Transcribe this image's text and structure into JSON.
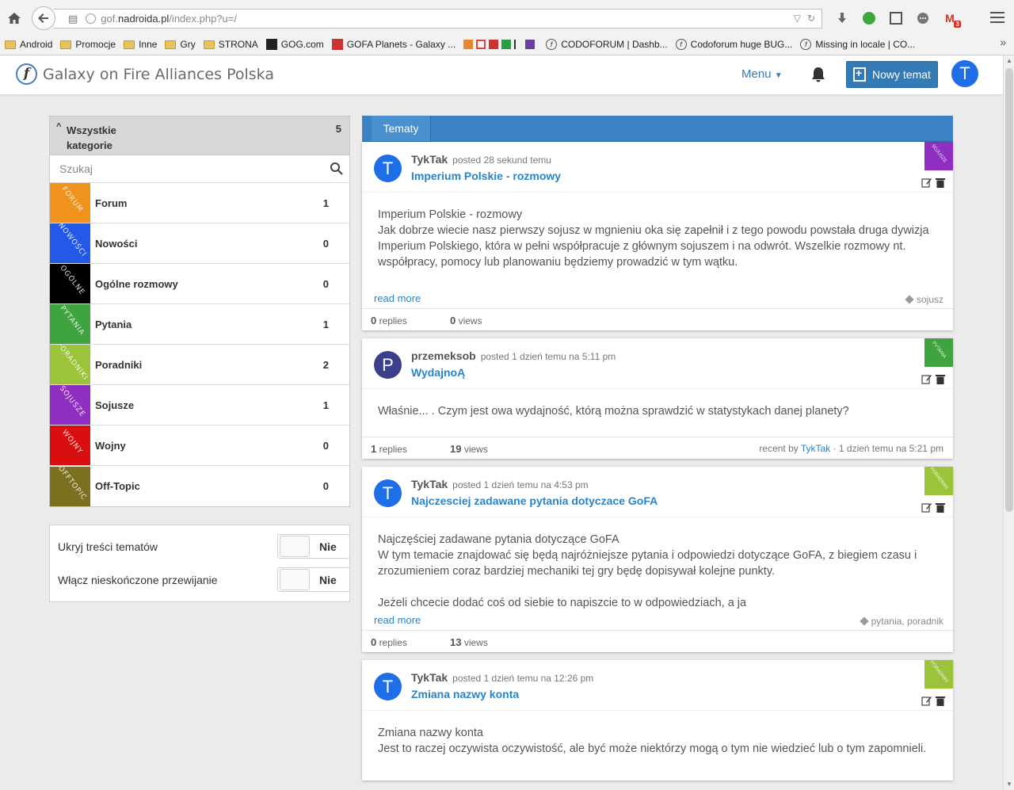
{
  "browser": {
    "url_prefix": "gof.",
    "url_domain": "nadroida.pl",
    "url_path": "/index.php?u=/",
    "gmail_count": "3",
    "bookmarks": [
      {
        "label": "Android",
        "icon": "folder"
      },
      {
        "label": "Promocje",
        "icon": "folder"
      },
      {
        "label": "Inne",
        "icon": "folder"
      },
      {
        "label": "Gry",
        "icon": "folder"
      },
      {
        "label": "STRONA",
        "icon": "folder"
      },
      {
        "label": "GOG.com",
        "icon": "gog"
      },
      {
        "label": "GOFA Planets - Galaxy ...",
        "icon": "gofa"
      },
      {
        "label": "CODOFORUM | Dashb...",
        "icon": "codo"
      },
      {
        "label": "Codoforum huge BUG...",
        "icon": "codo"
      },
      {
        "label": "Missing in locale | CO...",
        "icon": "codo"
      }
    ]
  },
  "header": {
    "logo_letter": "f",
    "site_title": "Galaxy on Fire Alliances Polska",
    "menu_label": "Menu",
    "new_topic_label": "Nowy temat",
    "user_initial": "T"
  },
  "sidebar": {
    "all_categories_label": "Wszystkie kategorie",
    "all_categories_count": "5",
    "search_placeholder": "Szukaj",
    "categories": [
      {
        "name": "Forum",
        "count": "1",
        "color": "#f0921e",
        "tile_text": "FORUM"
      },
      {
        "name": "Nowości",
        "count": "0",
        "color": "#2259e6",
        "tile_text": "NOWOŚCI"
      },
      {
        "name": "Ogólne rozmowy",
        "count": "0",
        "color": "#000000",
        "tile_text": "OGÓLNE"
      },
      {
        "name": "Pytania",
        "count": "1",
        "color": "#3fa43f",
        "tile_text": "PYTANIA"
      },
      {
        "name": "Poradniki",
        "count": "2",
        "color": "#9bc43a",
        "tile_text": "PORADNIKI"
      },
      {
        "name": "Sojusze",
        "count": "1",
        "color": "#8f2fc2",
        "tile_text": "SOJUSZE"
      },
      {
        "name": "Wojny",
        "count": "0",
        "color": "#d90e0e",
        "tile_text": "WOJNY"
      },
      {
        "name": "Off-Topic",
        "count": "0",
        "color": "#7a7020",
        "tile_text": "OFFTOPIC"
      }
    ],
    "settings": [
      {
        "label": "Ukryj treści tematów",
        "value": "Nie"
      },
      {
        "label": "Włącz nieskończone przewijanie",
        "value": "Nie"
      }
    ]
  },
  "main": {
    "tab_label": "Tematy",
    "read_more": "read more",
    "replies_label": "replies",
    "views_label": "views",
    "recent_by_label": "recent by",
    "topics": [
      {
        "author": "TykTak",
        "avatar": "T",
        "avatar_color": "#1e6ee8",
        "posted": "posted 28 sekund temu",
        "title": "Imperium Polskie - rozmowy",
        "badge_color": "#8f2fc2",
        "badge_text": "SOJUSZE",
        "body": [
          "Imperium Polskie - rozmowy",
          "Jak dobrze wiecie nasz pierwszy sojusz w mgnieniu oka się zapełnił i z tego powodu powstała druga dywizja Imperium Polskiego, która w pełni współpracuje z głównym sojuszem i na odwrót. Wszelkie rozmowy nt. współpracy, pomocy lub planowaniu będziemy prowadzić w tym wątku."
        ],
        "tags": "sojusz",
        "replies": "0",
        "views": "0"
      },
      {
        "author": "przemeksob",
        "avatar": "P",
        "avatar_color": "#3b3f8c",
        "posted": "posted 1 dzień temu na 5:11 pm",
        "title": "WydajnoĄ",
        "badge_color": "#3fa43f",
        "badge_text": "PYTANIA",
        "body": [
          "Właśnie... . Czym jest owa wydajność, którą można sprawdzić w statystykach danej planety?"
        ],
        "replies": "1",
        "views": "19",
        "recent_user": "TykTak",
        "recent_time": "1 dzień temu na 5:21 pm"
      },
      {
        "author": "TykTak",
        "avatar": "T",
        "avatar_color": "#1e6ee8",
        "posted": "posted 1 dzień temu na 4:53 pm",
        "title": "Najczesciej zadawane pytania dotyczace GoFA",
        "badge_color": "#9bc43a",
        "badge_text": "PORADNIKI",
        "body": [
          "Najczęściej zadawane pytania dotyczące GoFA",
          "W tym temacie znajdować się będą najróżniejsze pytania i odpowiedzi dotyczące GoFA, z biegiem czasu i zrozumieniem coraz bardziej mechaniki tej gry będę dopisywał kolejne punkty.",
          "",
          "Jeżeli chcecie dodać coś od siebie to napiszcie to w odpowiedziach, a ja"
        ],
        "tags": "pytania, poradnik",
        "replies": "0",
        "views": "13"
      },
      {
        "author": "TykTak",
        "avatar": "T",
        "avatar_color": "#1e6ee8",
        "posted": "posted 1 dzień temu na 12:26 pm",
        "title": "Zmiana nazwy konta",
        "badge_color": "#9bc43a",
        "badge_text": "PORADNIKI",
        "body": [
          "Zmiana nazwy konta",
          "Jest to raczej oczywista oczywistość, ale być może niektórzy mogą o tym nie wiedzieć lub o tym zapomnieli."
        ]
      }
    ]
  }
}
